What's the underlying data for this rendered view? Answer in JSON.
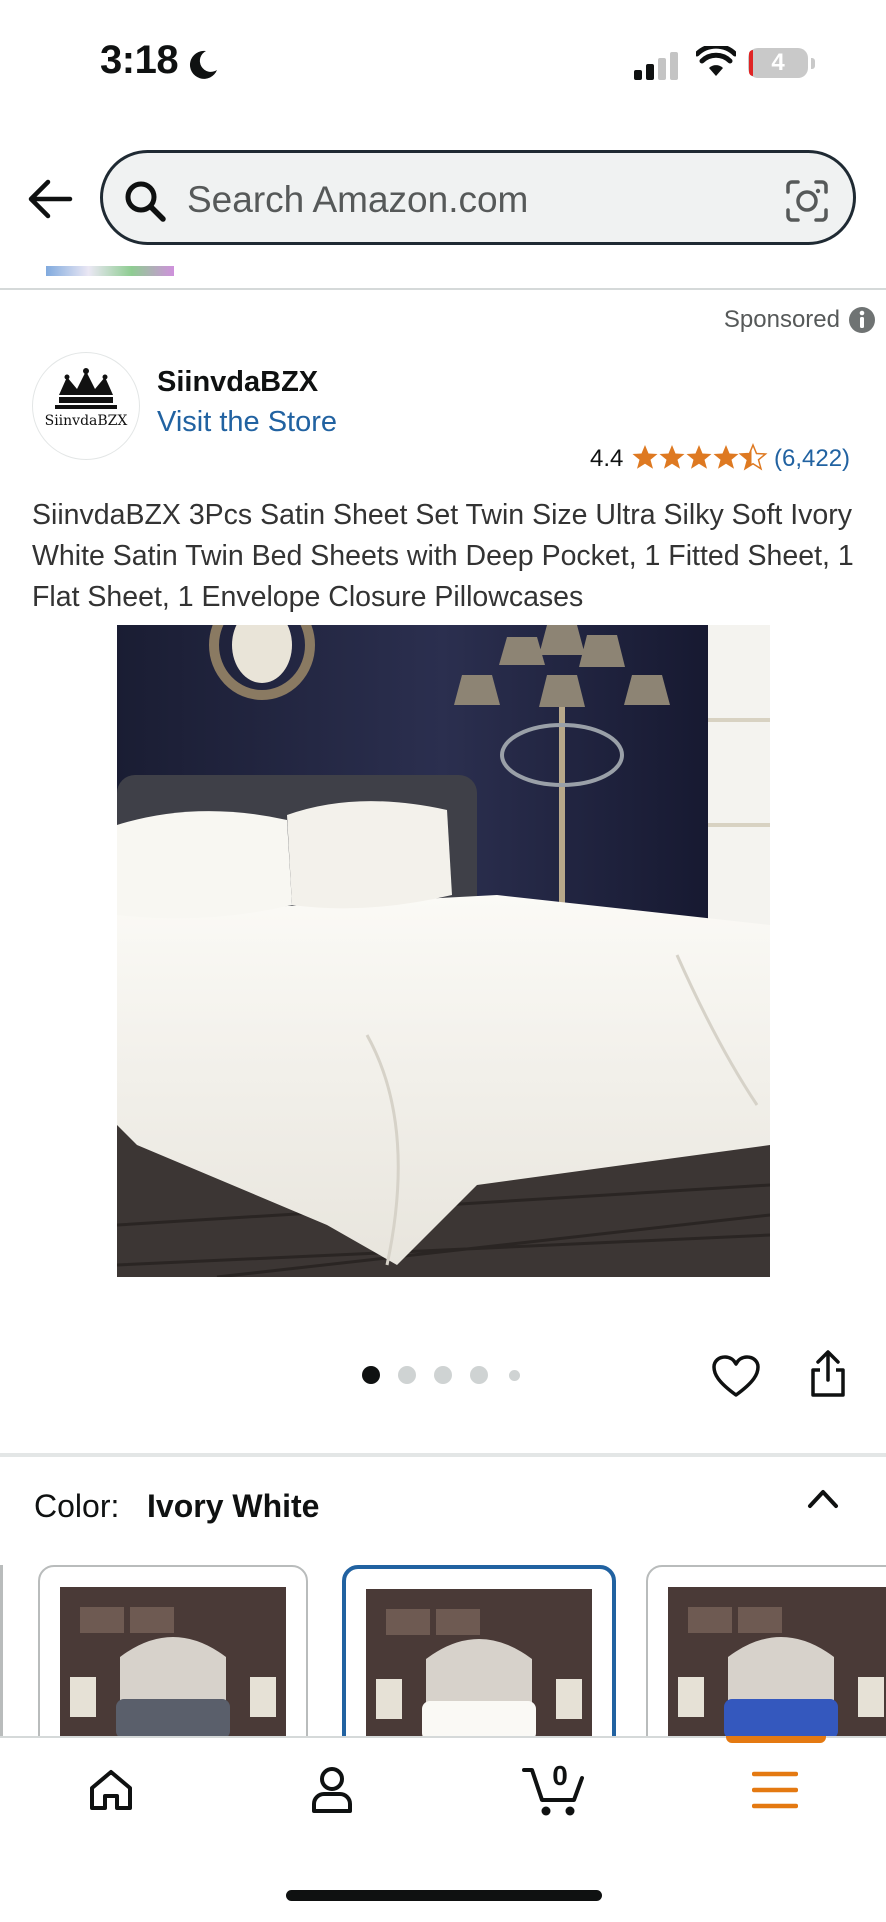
{
  "status_bar": {
    "time": "3:18",
    "battery": "4"
  },
  "search": {
    "placeholder": "Search Amazon.com"
  },
  "sponsored": "Sponsored",
  "brand": {
    "name": "SiinvdaBZX",
    "logo_text": "SiinvdaBZX",
    "store_link": "Visit the Store"
  },
  "rating": {
    "value": "4.4",
    "count": "(6,422)",
    "stars": 4.4
  },
  "product": {
    "title": "SiinvdaBZX 3Pcs Satin Sheet Set Twin Size Ultra Silky Soft Ivory White Satin Twin Bed Sheets with Deep Pocket, 1 Fitted Sheet, 1 Flat Sheet, 1 Envelope Closure Pillowcases",
    "image_count": 5,
    "active_image": 1
  },
  "variation": {
    "label": "Color:",
    "value": "Ivory White",
    "swatches": [
      {
        "name": "Grey",
        "color": "#4a4f5c",
        "selected": false
      },
      {
        "name": "Ivory White",
        "color": "#f1efea",
        "selected": true
      },
      {
        "name": "Navy Blue",
        "color": "#2b4aa8",
        "selected": false
      }
    ]
  },
  "cart": {
    "count": "0"
  },
  "colors": {
    "link": "#2162a1",
    "star": "#de7921",
    "accent": "#e47911",
    "selected_border": "#2162a1"
  },
  "icons": [
    "moon-icon",
    "signal-icon",
    "wifi-icon",
    "back-arrow-icon",
    "search-icon",
    "camera-icon",
    "info-icon",
    "heart-icon",
    "share-icon",
    "chevron-up-icon",
    "home-icon",
    "user-icon",
    "cart-icon",
    "menu-icon"
  ]
}
